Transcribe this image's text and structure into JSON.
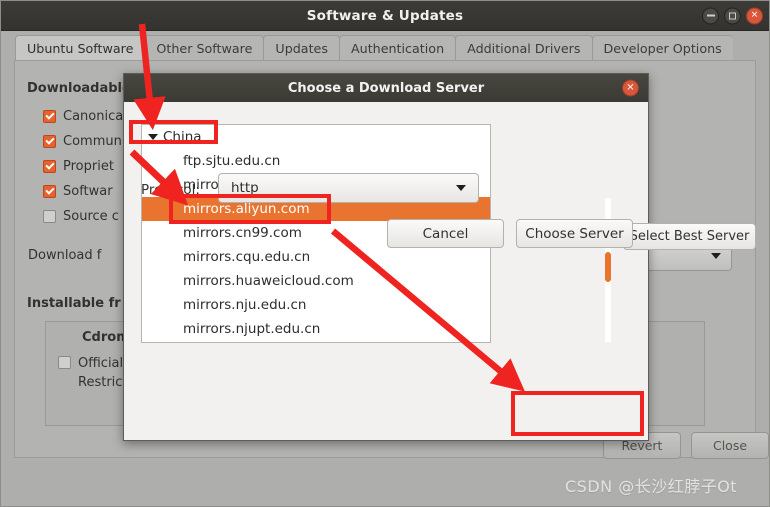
{
  "window": {
    "title": "Software & Updates",
    "buttons": {
      "minimize": "minimize-icon",
      "maximize": "maximize-icon",
      "close": "close-icon"
    },
    "tabs": [
      {
        "label": "Ubuntu Software",
        "active": true
      },
      {
        "label": "Other Software",
        "active": false
      },
      {
        "label": "Updates",
        "active": false
      },
      {
        "label": "Authentication",
        "active": false
      },
      {
        "label": "Additional Drivers",
        "active": false
      },
      {
        "label": "Developer Options",
        "active": false
      }
    ]
  },
  "background_panel": {
    "downloadable_heading": "Downloadable",
    "checkboxes": [
      {
        "label": "Canonica",
        "checked": true
      },
      {
        "label": "Commun",
        "checked": true
      },
      {
        "label": "Propriet",
        "checked": true
      },
      {
        "label": "Softwar",
        "checked": true
      },
      {
        "label": "Source c",
        "checked": false
      }
    ],
    "download_from_label": "Download f",
    "installable_heading": "Installable fr",
    "cdrom_heading": "Cdrom w",
    "cdrom_option_line1": "Officially",
    "cdrom_option_line2": "Restrict",
    "revert_button": "Revert",
    "close_button": "Close"
  },
  "dialog": {
    "title": "Choose a Download Server",
    "close_icon": "close-icon",
    "select_best_server_button": "Select Best Server",
    "protocol_label": "Protocol:",
    "protocol_value": "http",
    "cancel_button": "Cancel",
    "choose_server_button": "Choose Server",
    "server_list": [
      {
        "label": "China",
        "type": "group",
        "expanded": true,
        "selected": false
      },
      {
        "label": "ftp.sjtu.edu.cn",
        "type": "server",
        "selected": false
      },
      {
        "label": "mirror.lzu.edu.cn",
        "type": "server",
        "selected": false
      },
      {
        "label": "mirrors.aliyun.com",
        "type": "server",
        "selected": true
      },
      {
        "label": "mirrors.cn99.com",
        "type": "server",
        "selected": false
      },
      {
        "label": "mirrors.cqu.edu.cn",
        "type": "server",
        "selected": false
      },
      {
        "label": "mirrors.huaweicloud.com",
        "type": "server",
        "selected": false
      },
      {
        "label": "mirrors.nju.edu.cn",
        "type": "server",
        "selected": false
      },
      {
        "label": "mirrors.njupt.edu.cn",
        "type": "server",
        "selected": false
      }
    ]
  },
  "annotations": {
    "highlight_color": "#ef2420",
    "arrow_count": 3,
    "boxes": [
      {
        "target": "China group row"
      },
      {
        "target": "mirrors.aliyun.com row"
      },
      {
        "target": "Choose Server button"
      }
    ]
  },
  "watermark": {
    "text": "CSDN @长沙红脖子Ot"
  },
  "colors": {
    "accent_orange": "#e8742f",
    "annotation_red": "#ef2420",
    "titlebar_dark": "#3c3b37",
    "window_gray": "#aeaeac",
    "dialog_bg": "#f2f1ef"
  }
}
